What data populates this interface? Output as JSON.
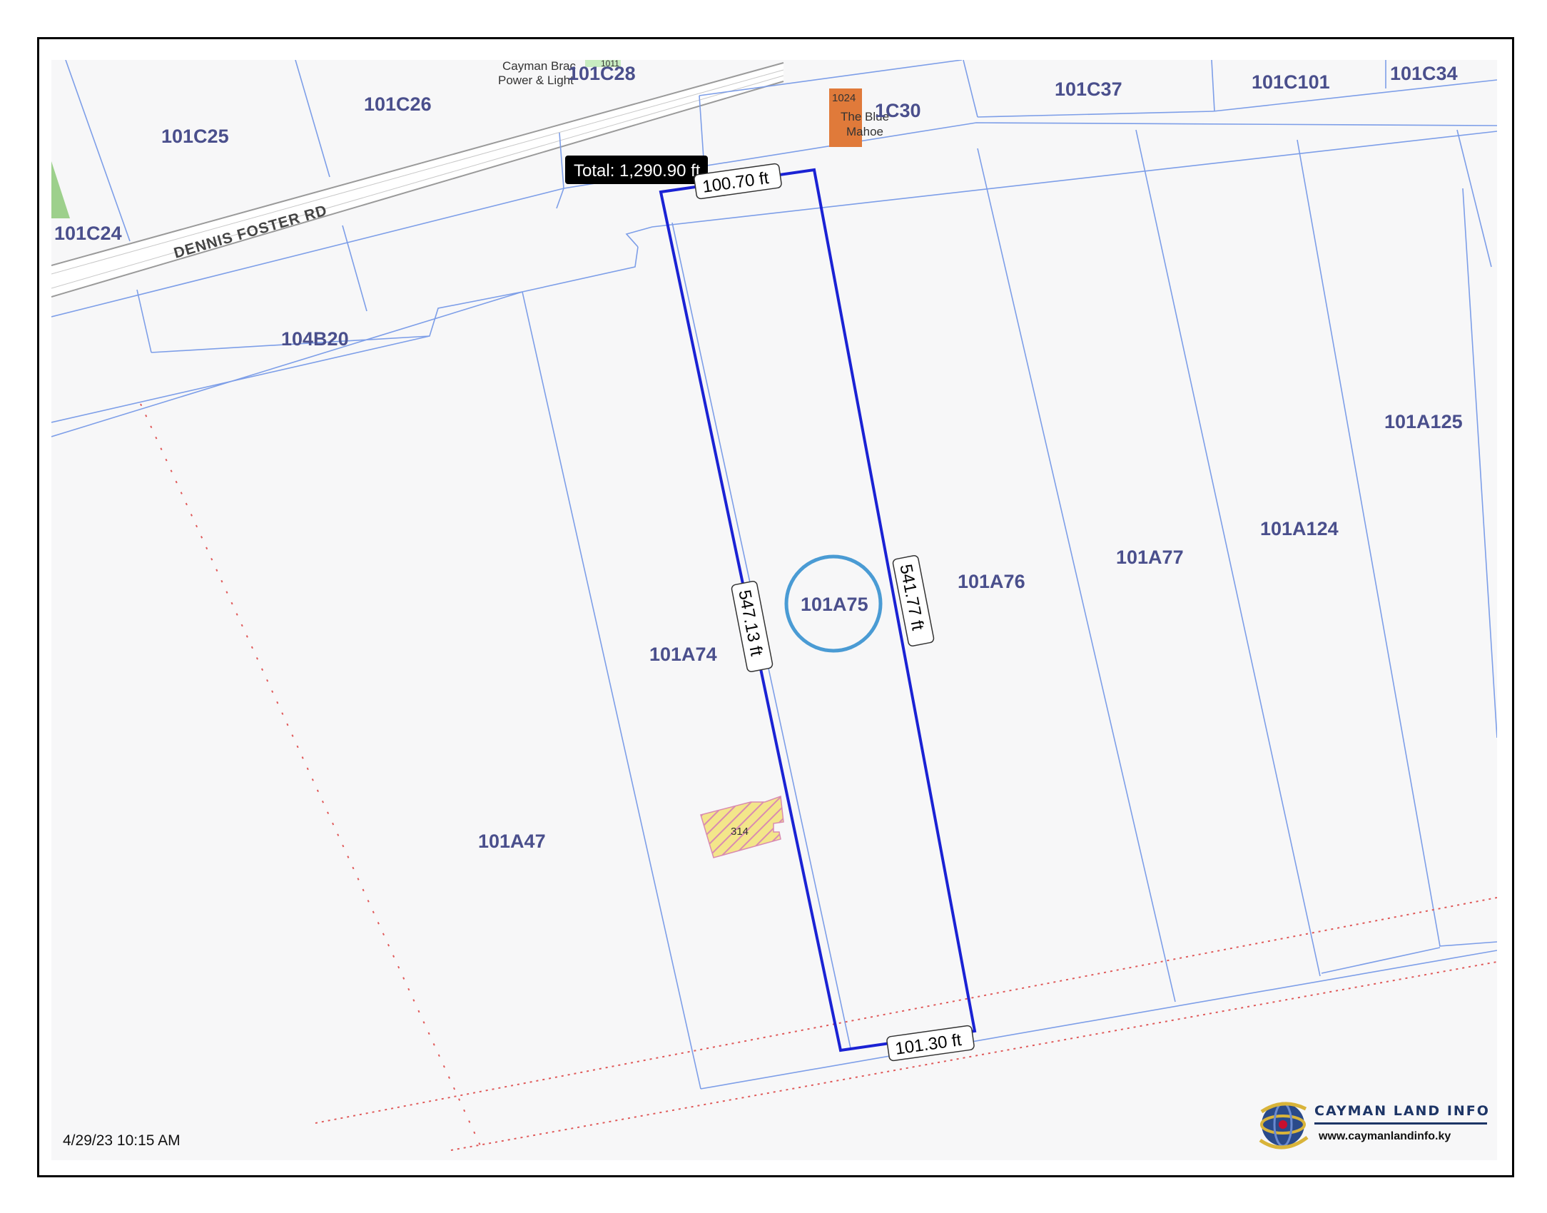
{
  "map": {
    "parcels": [
      {
        "label": "101C25"
      },
      {
        "label": "101C26"
      },
      {
        "label": "101C28"
      },
      {
        "label": "101C24"
      },
      {
        "label": "1C30"
      },
      {
        "label": "101C37"
      },
      {
        "label": "101C101"
      },
      {
        "label": "101C34"
      },
      {
        "label": "104B20"
      },
      {
        "label": "101A125"
      },
      {
        "label": "101A124"
      },
      {
        "label": "101A77"
      },
      {
        "label": "101A76"
      },
      {
        "label": "101A75"
      },
      {
        "label": "101A74"
      },
      {
        "label": "101A47"
      }
    ],
    "road_name": "DENNIS FOSTER RD",
    "poi": {
      "power_line1": "Cayman Brac",
      "power_line2": "Power & Light",
      "power_number": "1011",
      "mahoe_number": "1024",
      "mahoe_line1": "The Blue",
      "mahoe_line2": "Mahoe",
      "building_number": "314"
    },
    "measurements": {
      "total": "Total: 1,290.90 ft",
      "top": "100.70 ft",
      "left": "547.13 ft",
      "right": "541.77 ft",
      "bottom": "101.30 ft"
    },
    "colors": {
      "selected_outline": "#1a22d4",
      "parcel_line": "#7d9ee8",
      "highlight_circle": "#4a9bd4",
      "survey_line": "#e05a5a",
      "building_fill": "#f0e68c",
      "poi_fill": "#e07a3a"
    }
  },
  "timestamp": "4/29/23 10:15 AM",
  "logo": {
    "name": "CAYMAN LAND INFO",
    "url": "www.caymanlandinfo.ky"
  }
}
